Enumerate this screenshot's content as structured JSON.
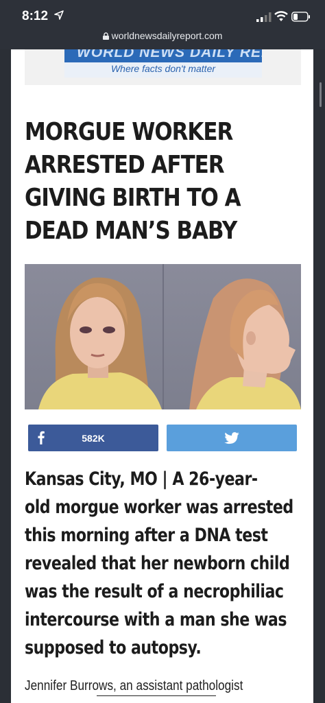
{
  "status_bar": {
    "time": "8:12",
    "url": "worldnewsdailyreport.com"
  },
  "banner": {
    "logo": "WORLD NEWS DAILY REPORT",
    "tagline": "Where facts don't matter"
  },
  "article": {
    "headline_lines": [
      "MORGUE WORKER",
      "ARRESTED AFTER",
      "GIVING BIRTH TO A",
      "DEAD MAN’S BABY"
    ],
    "share": {
      "facebook_count": "582K"
    },
    "lead_lines": [
      "Kansas City, MO | A 26-year-",
      "old morgue worker was arrested",
      "this morning after a DNA test",
      "revealed that her newborn child",
      "was the result of a necrophiliac",
      "intercourse with a man she was",
      "supposed to autopsy."
    ],
    "body_start": "Jennifer Burrows, an assistant pathologist"
  },
  "colors": {
    "facebook": "#3c5a99",
    "twitter": "#5a9fdc",
    "status_bar": "#2d3139"
  }
}
